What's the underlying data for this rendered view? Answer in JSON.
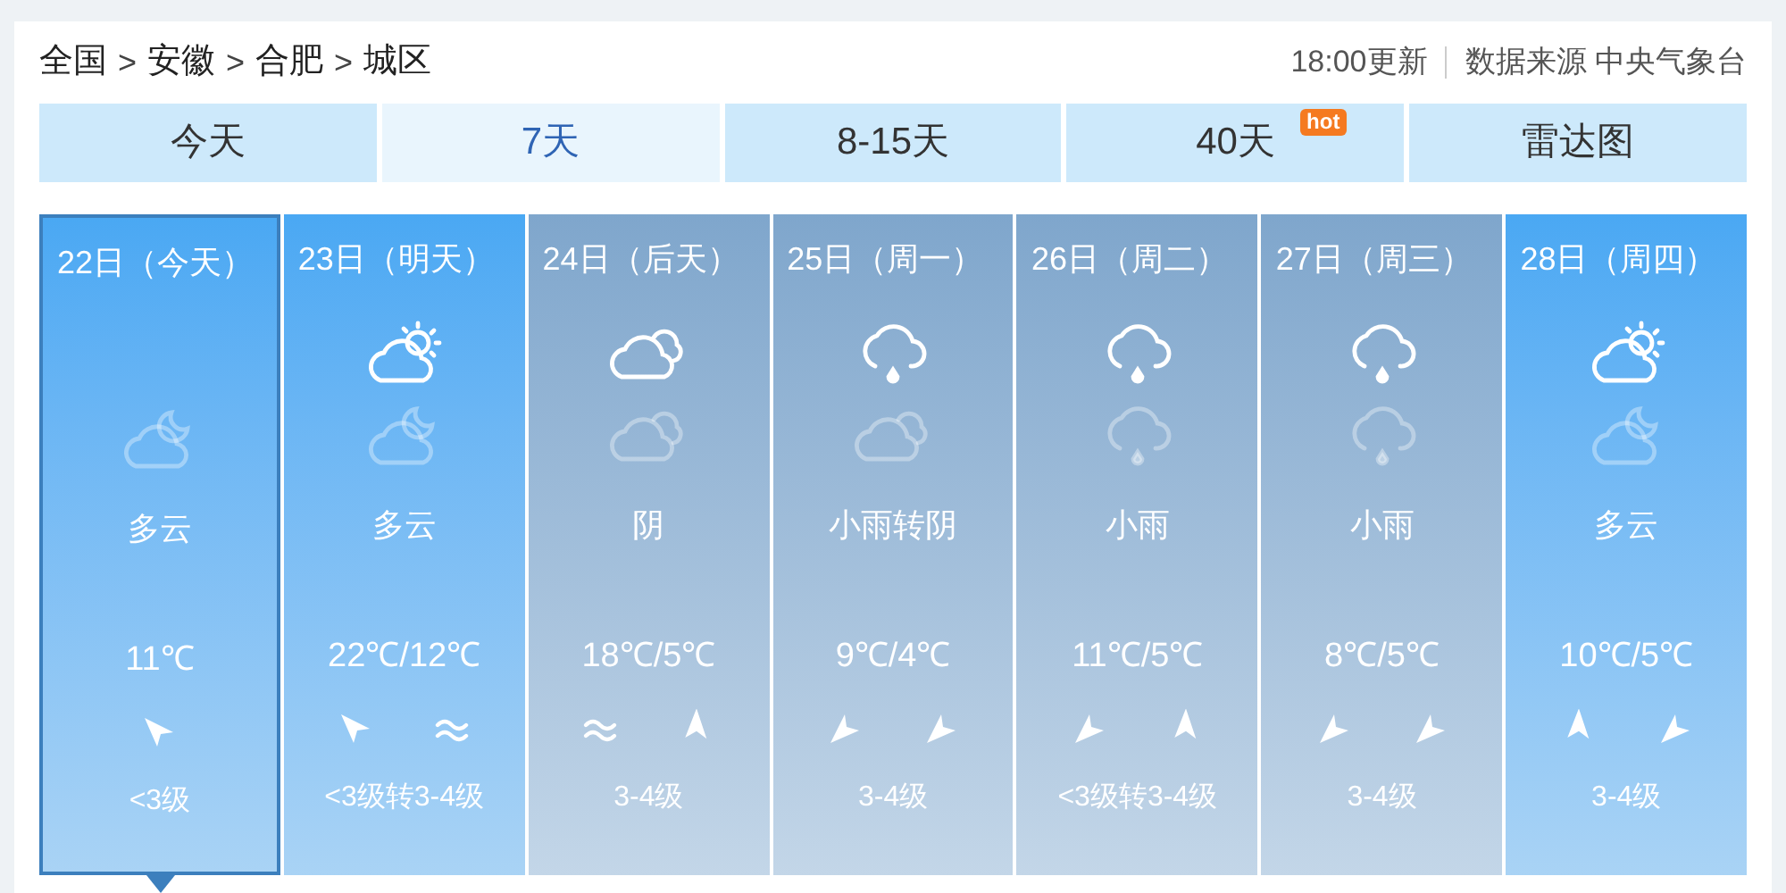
{
  "breadcrumb": [
    {
      "kind": "link",
      "text": "全国"
    },
    {
      "kind": "sep",
      "text": ">"
    },
    {
      "kind": "link",
      "text": "安徽"
    },
    {
      "kind": "sep",
      "text": ">"
    },
    {
      "kind": "link",
      "text": "合肥"
    },
    {
      "kind": "sep",
      "text": ">"
    },
    {
      "kind": "link",
      "text": "城区"
    }
  ],
  "update_time": "18:00更新",
  "source": "数据来源 中央气象台",
  "tabs": [
    {
      "label": "今天",
      "selected": false
    },
    {
      "label": "7天",
      "selected": true
    },
    {
      "label": "8-15天",
      "selected": false
    },
    {
      "label": "40天",
      "selected": false,
      "badge": "hot"
    },
    {
      "label": "雷达图",
      "selected": false
    }
  ],
  "days": [
    {
      "date": "22日（今天）",
      "selected": true,
      "bright": true,
      "night_icon": {
        "kind": "moon-cloud"
      },
      "weather": "多云",
      "temp": "11℃",
      "wind": [
        {
          "kind": "pointer-se"
        }
      ],
      "wind_level": "<3级"
    },
    {
      "date": "23日（明天）",
      "selected": false,
      "bright": true,
      "day_icon": {
        "kind": "sun-cloud"
      },
      "night_icon": {
        "kind": "moon-cloud"
      },
      "weather": "多云",
      "temp": "22℃/12℃",
      "wind": [
        {
          "kind": "pointer-se"
        },
        {
          "kind": "calm"
        }
      ],
      "wind_level": "<3级转3-4级"
    },
    {
      "date": "24日（后天）",
      "selected": false,
      "bright": false,
      "day_icon": {
        "kind": "cloudy"
      },
      "night_icon": {
        "kind": "cloudy"
      },
      "weather": "阴",
      "temp": "18℃/5℃",
      "wind": [
        {
          "kind": "calm"
        },
        {
          "kind": "pointer-s"
        }
      ],
      "wind_level": "3-4级"
    },
    {
      "date": "25日（周一）",
      "selected": false,
      "bright": false,
      "day_icon": {
        "kind": "rain"
      },
      "night_icon": {
        "kind": "cloudy"
      },
      "weather": "小雨转阴",
      "temp": "9℃/4℃",
      "wind": [
        {
          "kind": "pointer-ne"
        },
        {
          "kind": "pointer-ne"
        }
      ],
      "wind_level": "3-4级"
    },
    {
      "date": "26日（周二）",
      "selected": false,
      "bright": false,
      "day_icon": {
        "kind": "rain"
      },
      "night_icon": {
        "kind": "rain"
      },
      "weather": "小雨",
      "temp": "11℃/5℃",
      "wind": [
        {
          "kind": "pointer-ne"
        },
        {
          "kind": "pointer-s"
        }
      ],
      "wind_level": "<3级转3-4级"
    },
    {
      "date": "27日（周三）",
      "selected": false,
      "bright": false,
      "day_icon": {
        "kind": "rain"
      },
      "night_icon": {
        "kind": "rain"
      },
      "weather": "小雨",
      "temp": "8℃/5℃",
      "wind": [
        {
          "kind": "pointer-ne"
        },
        {
          "kind": "pointer-ne"
        }
      ],
      "wind_level": "3-4级"
    },
    {
      "date": "28日（周四）",
      "selected": false,
      "bright": true,
      "day_icon": {
        "kind": "sun-cloud"
      },
      "night_icon": {
        "kind": "moon-cloud"
      },
      "weather": "多云",
      "temp": "10℃/5℃",
      "wind": [
        {
          "kind": "pointer-s"
        },
        {
          "kind": "pointer-ne"
        }
      ],
      "wind_level": "3-4级"
    }
  ]
}
